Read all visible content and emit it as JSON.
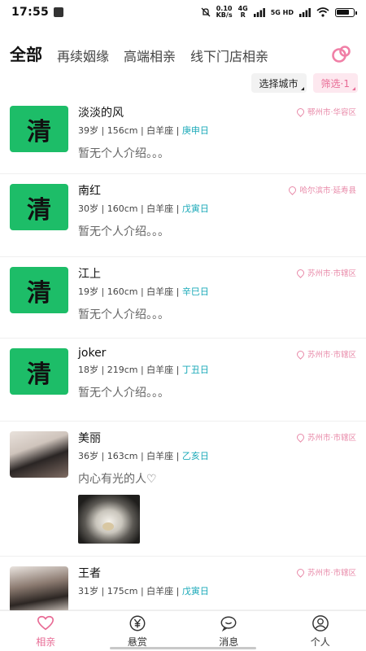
{
  "status_bar": {
    "time": "17:55",
    "net_speed": "0.10",
    "net_unit": "KB/s",
    "sig1": "4G",
    "sig1_sub": "R",
    "sig2": "5G HD",
    "battery_level": 0.8
  },
  "tabs": [
    {
      "label": "全部",
      "active": true
    },
    {
      "label": "再续姻缘",
      "active": false
    },
    {
      "label": "高端相亲",
      "active": false
    },
    {
      "label": "线下门店相亲",
      "active": false
    }
  ],
  "filters": {
    "city": "选择城市",
    "screen": "筛选·1"
  },
  "profiles": [
    {
      "name": "淡淡的风",
      "avatar_text": "清",
      "age": "39岁",
      "height": "156cm",
      "zodiac": "白羊座",
      "day": "庚申日",
      "location": "鄂州市·华容区",
      "bio": "暂无个人介绍。。。"
    },
    {
      "name": "南红",
      "avatar_text": "清",
      "age": "30岁",
      "height": "160cm",
      "zodiac": "白羊座",
      "day": "戊寅日",
      "location": "哈尔滨市·延寿县",
      "bio": "暂无个人介绍。。。"
    },
    {
      "name": "江上",
      "avatar_text": "清",
      "age": "19岁",
      "height": "160cm",
      "zodiac": "白羊座",
      "day": "辛巳日",
      "location": "苏州市·市辖区",
      "bio": "暂无个人介绍。。。"
    },
    {
      "name": "joker",
      "avatar_text": "清",
      "age": "18岁",
      "height": "219cm",
      "zodiac": "白羊座",
      "day": "丁丑日",
      "location": "苏州市·市辖区",
      "bio": "暂无个人介绍。。。"
    },
    {
      "name": "美丽",
      "age": "36岁",
      "height": "163cm",
      "zodiac": "白羊座",
      "day": "乙亥日",
      "location": "苏州市·市辖区",
      "bio": "内心有光的人♡"
    },
    {
      "name": "王者",
      "age": "31岁",
      "height": "175cm",
      "zodiac": "白羊座",
      "day": "戊寅日",
      "location": "苏州市·市辖区"
    }
  ],
  "bottom_nav": [
    {
      "label": "相亲",
      "icon": "heart-icon",
      "active": true
    },
    {
      "label": "悬赏",
      "icon": "yen-coin-icon",
      "active": false
    },
    {
      "label": "消息",
      "icon": "chat-bubble-icon",
      "active": false
    },
    {
      "label": "个人",
      "icon": "person-icon",
      "active": false
    }
  ],
  "colors": {
    "accent": "#e86b95",
    "avatar_green": "#1dbd68",
    "day_teal": "#1aa9b8"
  }
}
